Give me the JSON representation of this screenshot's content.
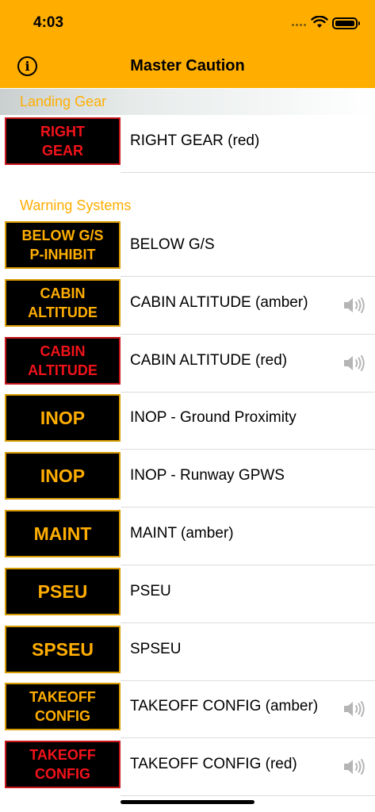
{
  "status_bar": {
    "time": "4:03"
  },
  "nav": {
    "title": "Master Caution",
    "info_icon": "info-icon"
  },
  "sections": [
    {
      "header": "Landing Gear",
      "rows": [
        {
          "badge": "RIGHT\nGEAR",
          "badge_color": "red",
          "label": "RIGHT GEAR (red)",
          "has_sound": false
        }
      ]
    },
    {
      "header": "Warning Systems",
      "rows": [
        {
          "badge": "BELOW G/S\nP-INHIBIT",
          "badge_color": "amber",
          "label": "BELOW G/S",
          "has_sound": false
        },
        {
          "badge": "CABIN\nALTITUDE",
          "badge_color": "amber",
          "label": "CABIN ALTITUDE (amber)",
          "has_sound": true
        },
        {
          "badge": "CABIN\nALTITUDE",
          "badge_color": "red",
          "label": "CABIN ALTITUDE (red)",
          "has_sound": true
        },
        {
          "badge": "INOP",
          "badge_color": "amber",
          "label": "INOP - Ground Proximity",
          "has_sound": false
        },
        {
          "badge": "INOP",
          "badge_color": "amber",
          "label": "INOP - Runway GPWS",
          "has_sound": false
        },
        {
          "badge": "MAINT",
          "badge_color": "amber",
          "label": "MAINT (amber)",
          "has_sound": false
        },
        {
          "badge": "PSEU",
          "badge_color": "amber",
          "label": "PSEU",
          "has_sound": false
        },
        {
          "badge": "SPSEU",
          "badge_color": "amber",
          "label": "SPSEU",
          "has_sound": false
        },
        {
          "badge": "TAKEOFF\nCONFIG",
          "badge_color": "amber",
          "label": "TAKEOFF CONFIG (amber)",
          "has_sound": true
        },
        {
          "badge": "TAKEOFF\nCONFIG",
          "badge_color": "red",
          "label": "TAKEOFF CONFIG (red)",
          "has_sound": true
        }
      ]
    }
  ],
  "colors": {
    "accent": "#FFAE00",
    "badge_red": "#F2131A",
    "badge_amber": "#FFAE00"
  }
}
